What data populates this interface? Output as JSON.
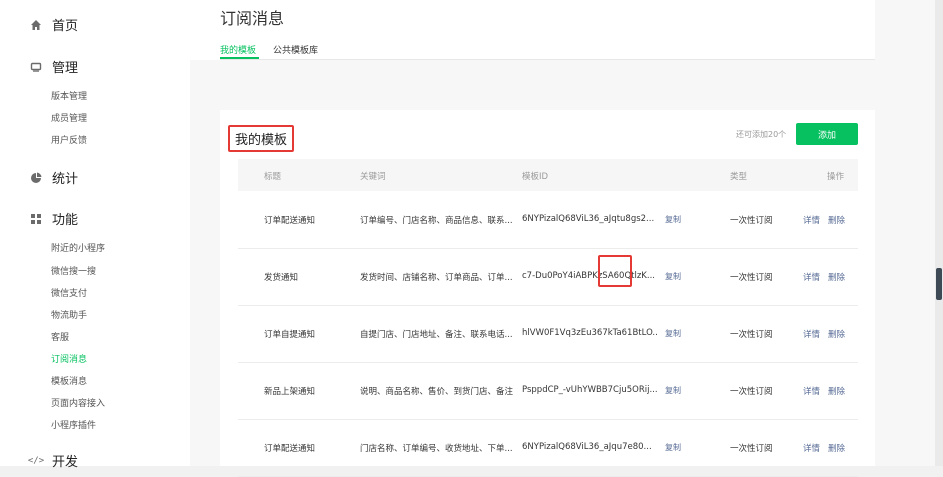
{
  "sidebar": {
    "home": {
      "label": "首页",
      "icon": "home-icon"
    },
    "manage": {
      "label": "管理",
      "icon": "monitor-icon",
      "items": [
        "版本管理",
        "成员管理",
        "用户反馈"
      ]
    },
    "stats": {
      "label": "统计",
      "icon": "pie-chart-icon"
    },
    "features": {
      "label": "功能",
      "icon": "grid-icon",
      "items": [
        "附近的小程序",
        "微信搜一搜",
        "微信支付",
        "物流助手",
        "客服",
        "订阅消息",
        "模板消息",
        "页面内容接入",
        "小程序插件"
      ],
      "active": "订阅消息"
    },
    "dev": {
      "label": "开发",
      "icon": "code-icon"
    }
  },
  "page": {
    "title": "订阅消息",
    "tabs": [
      "我的模板",
      "公共模板库"
    ]
  },
  "card": {
    "title": "我的模板",
    "remaining": "还可添加20个",
    "add_label": "添加"
  },
  "table": {
    "headers": [
      "标题",
      "关键词",
      "模板ID",
      "类型",
      "操作"
    ],
    "copy_label": "复制",
    "detail_label": "详情",
    "delete_label": "删除",
    "rows": [
      {
        "title": "订单配送通知",
        "keywords": "订单编号、门店名称、商品信息、联系...",
        "template_id": "6NYPizalQ68ViL36_aJqtu8gs2...",
        "type": "一次性订阅"
      },
      {
        "title": "发货通知",
        "keywords": "发货时间、店铺名称、订单商品、订单...",
        "template_id": "c7-Du0PoY4iABPKzSA60QtlzK...",
        "type": "一次性订阅"
      },
      {
        "title": "订单自提通知",
        "keywords": "自提门店、门店地址、备注、联系电话...",
        "template_id": "hlVW0F1Vq3zEu367kTa61BtLO...",
        "type": "一次性订阅"
      },
      {
        "title": "新品上架通知",
        "keywords": "说明、商品名称、售价、到货门店、备注",
        "template_id": "PsppdCP_-vUhYWBB7Cju5ORij...",
        "type": "一次性订阅"
      },
      {
        "title": "订单配送通知",
        "keywords": "门店名称、订单编号、收货地址、下单...",
        "template_id": "6NYPizalQ68ViL36_aJqu7e80...",
        "type": "一次性订阅"
      }
    ]
  }
}
